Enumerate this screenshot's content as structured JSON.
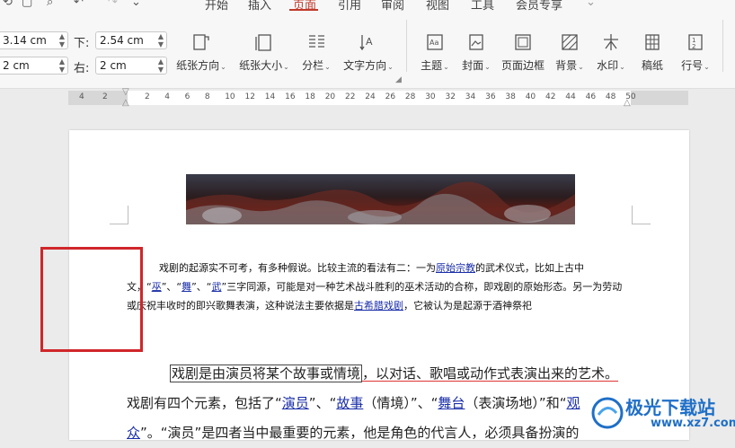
{
  "menu": {
    "tabs": [
      {
        "label": "开始",
        "active": false
      },
      {
        "label": "插入",
        "active": false
      },
      {
        "label": "页面",
        "active": true
      },
      {
        "label": "引用",
        "active": false
      },
      {
        "label": "审阅",
        "active": false
      },
      {
        "label": "视图",
        "active": false
      },
      {
        "label": "工具",
        "active": false
      },
      {
        "label": "会员专享",
        "active": false
      }
    ]
  },
  "margins": {
    "top_value": "3.14 cm",
    "bottom_label": "下:",
    "bottom_value": "2.54 cm",
    "left_value": "2 cm",
    "right_label": "右:",
    "right_value": "2 cm"
  },
  "ribbon": {
    "orientation": "纸张方向",
    "size": "纸张大小",
    "columns": "分栏",
    "text_direction": "文字方向",
    "theme": "主题",
    "cover": "封面",
    "page_border": "页面边框",
    "background": "背景",
    "watermark": "水印",
    "draft": "稿纸",
    "line_number": "行号"
  },
  "ruler": {
    "left_numbers": [
      "4",
      "2"
    ],
    "numbers": [
      "2",
      "4",
      "6",
      "8",
      "10",
      "12",
      "14",
      "16",
      "18",
      "20",
      "22",
      "24",
      "26",
      "28",
      "30",
      "32",
      "34",
      "36",
      "38",
      "40",
      "42",
      "44",
      "46",
      "48",
      "50"
    ]
  },
  "document": {
    "para1": {
      "t1": "戏剧的起源实不可考，有多种假说。比较主流的看法有二：一为",
      "link1": "原始宗教",
      "t2": "的武术仪式，比如上古中文，“",
      "link2": "巫",
      "t3": "”、“",
      "link3": "舞",
      "t4": "”、“",
      "link4": "武",
      "t5": "”三字同源，可能是对一种艺术战斗胜利的巫术活动的合称，即戏剧的原始形态。另一为劳动或庆祝丰收时的即兴歌舞表演，这种说法主要依据是",
      "link5": "古希腊戏剧",
      "t6": "，它被认为是起源于酒神祭祀"
    },
    "para2": {
      "boxed": "戏剧是由演员将某个故事或情境",
      "t1": "，以对话、歌唱或动作式表演出来的艺术。",
      "t2": "戏剧有四个元素，包括了“",
      "link1": "演员",
      "t3": "”、“",
      "link2": "故事",
      "t4": "（情境）”、“",
      "link3": "舞台",
      "t5": "（表演场地）”和“",
      "link4": "观众",
      "t6": "”。“演员”是四者当中最重要的元素，他是角色的代言人，必须具备扮演的"
    }
  },
  "watermark": {
    "title": "极光下载站",
    "url": "www.xz7.com"
  },
  "colors": {
    "accent": "#c0392b",
    "link": "#1a2ea8",
    "highlight_box": "#d0262a"
  }
}
